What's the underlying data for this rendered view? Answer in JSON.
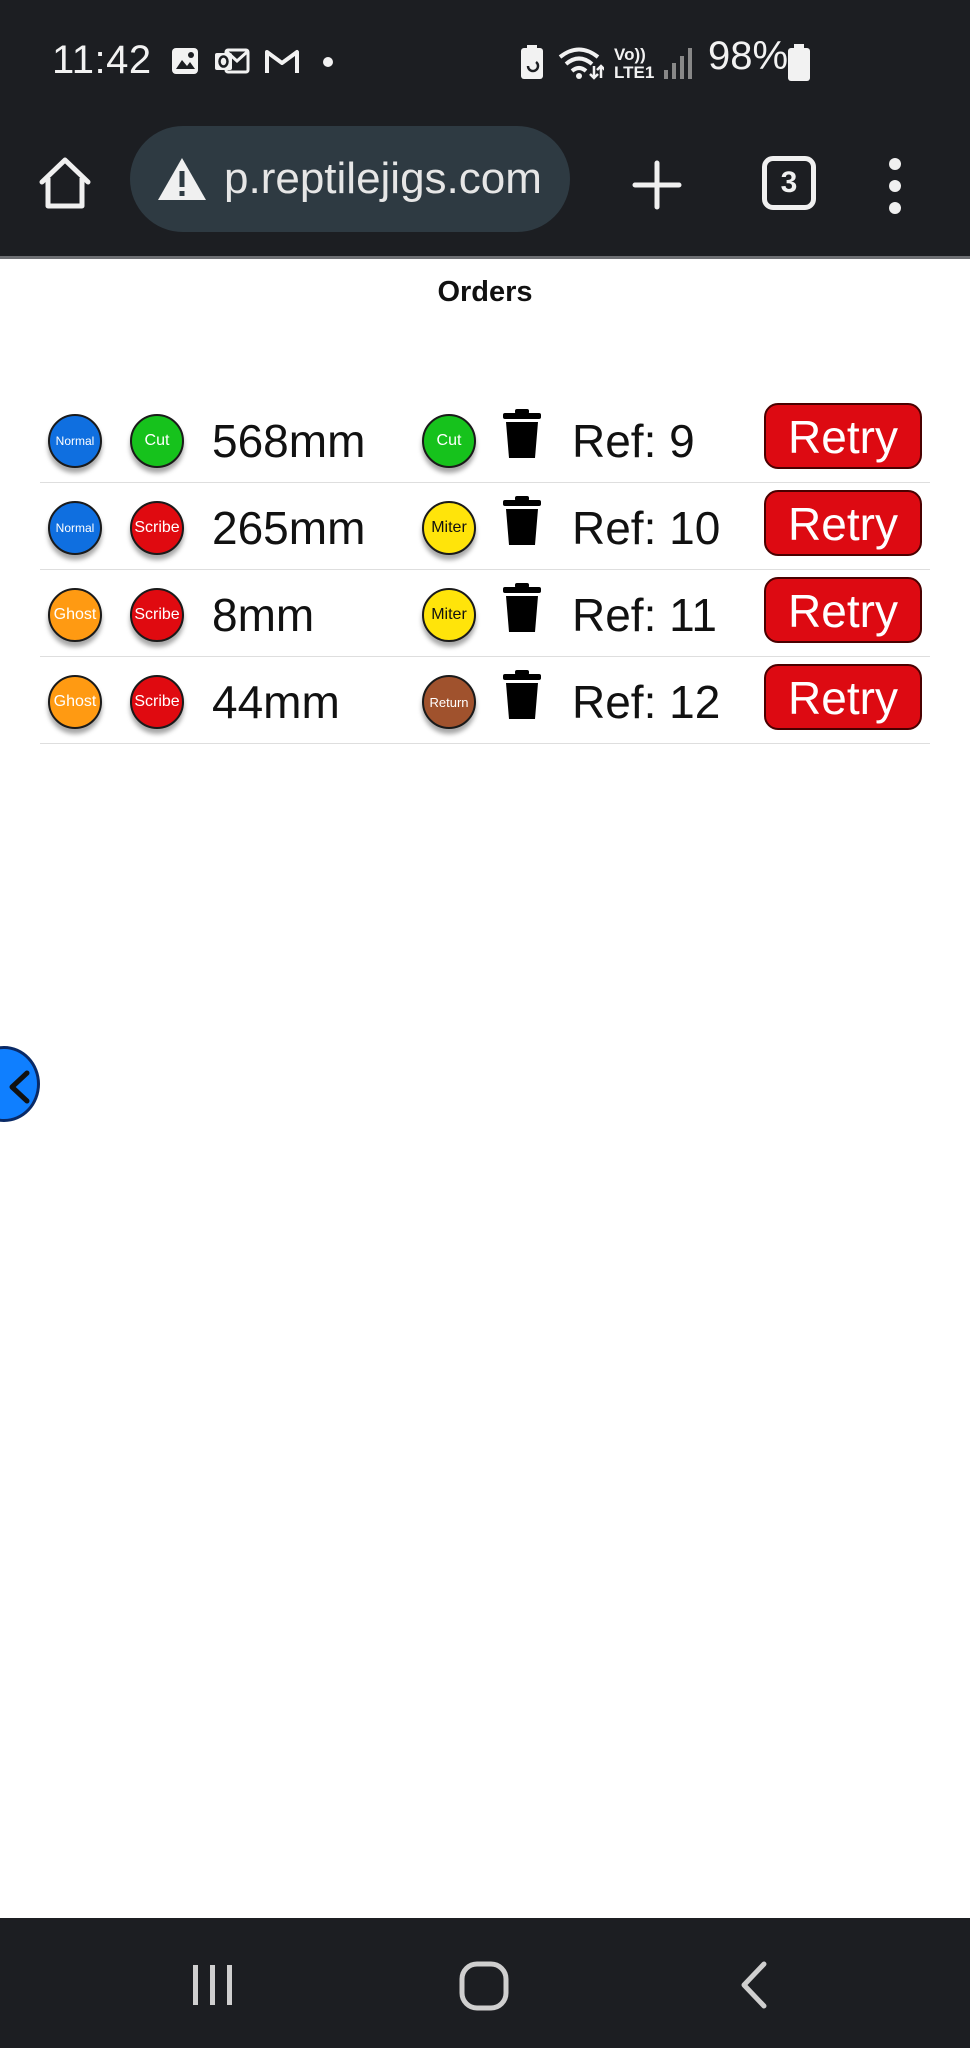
{
  "status_bar": {
    "time": "11:42",
    "battery": "98%",
    "network": "Vo))\nLTE1",
    "icons": [
      "gallery-icon",
      "outlook-icon",
      "gmail-icon",
      "dot-icon",
      "battery-saver-icon",
      "wifi-icon",
      "signal-icon",
      "battery-icon"
    ]
  },
  "browser": {
    "url": "p.reptilejigs.com",
    "tab_count": "3",
    "icons": [
      "home-icon",
      "warning-icon",
      "plus-icon",
      "tabs-icon",
      "more-vert-icon"
    ]
  },
  "page": {
    "title": "Orders",
    "rows": [
      {
        "profile": "Normal",
        "mode": "Cut",
        "length": "568mm",
        "end": "Cut",
        "ref": "Ref: 9",
        "action": "Retry"
      },
      {
        "profile": "Normal",
        "mode": "Scribe",
        "length": "265mm",
        "end": "Miter",
        "ref": "Ref: 10",
        "action": "Retry"
      },
      {
        "profile": "Ghost",
        "mode": "Scribe",
        "length": "8mm",
        "end": "Miter",
        "ref": "Ref: 11",
        "action": "Retry"
      },
      {
        "profile": "Ghost",
        "mode": "Scribe",
        "length": "44mm",
        "end": "Return",
        "ref": "Ref: 12",
        "action": "Retry"
      }
    ]
  },
  "colors": {
    "Normal": "#0f6fe0",
    "Ghost": "#ff9a12",
    "Cut": "#16c21c",
    "Scribe": "#e00a10",
    "Miter": "#ffe40a",
    "Return": "#a0522d",
    "retry": "#dd0a12",
    "bars": "#1c1e22"
  },
  "nav": {
    "icons": [
      "recents-icon",
      "home-nav-icon",
      "back-icon"
    ]
  }
}
